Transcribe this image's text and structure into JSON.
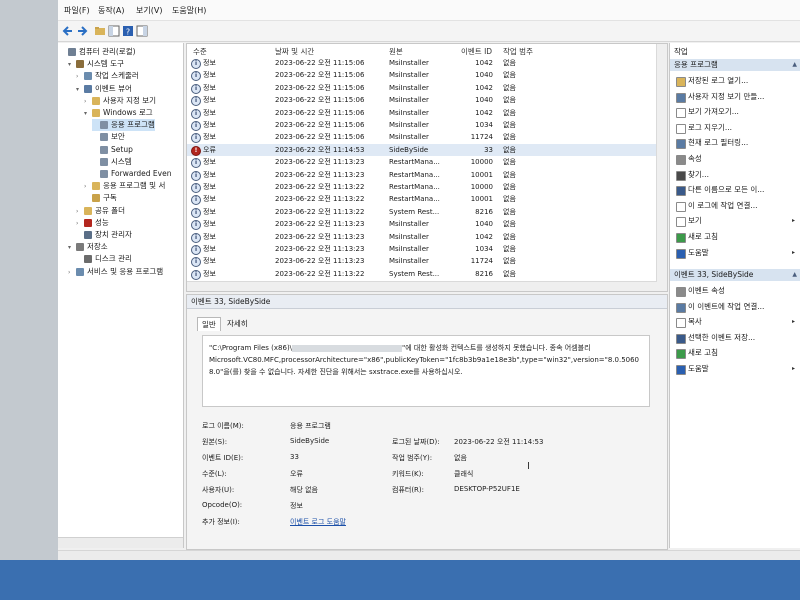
{
  "menu": {
    "items": [
      "파일(F)",
      "동작(A)",
      "보기(V)",
      "도움말(H)"
    ]
  },
  "toolbar": {
    "icons": [
      "back-arrow-icon",
      "forward-arrow-icon",
      "folder-up-icon",
      "console-tree-icon",
      "help-icon",
      "show-actions-icon"
    ]
  },
  "tree": {
    "items": [
      {
        "label": "컴퓨터 관리(로컬)",
        "level": 0,
        "expand": "",
        "icon": "computer-management-icon",
        "color": "#6f7f93"
      },
      {
        "label": "시스템 도구",
        "level": 1,
        "expand": "▾",
        "icon": "toolbox-icon",
        "color": "#8a6d3b"
      },
      {
        "label": "작업 스케줄러",
        "level": 2,
        "expand": "›",
        "icon": "clock-icon",
        "color": "#6b8cae"
      },
      {
        "label": "이벤트 뷰어",
        "level": 2,
        "expand": "▾",
        "icon": "event-viewer-icon",
        "color": "#5a7ba3"
      },
      {
        "label": "사용자 지정 보기",
        "level": 3,
        "expand": "›",
        "icon": "folder-icon",
        "color": "#d9b45a"
      },
      {
        "label": "Windows 로그",
        "level": 3,
        "expand": "▾",
        "icon": "folder-icon",
        "color": "#d9b45a"
      },
      {
        "label": "응용 프로그램",
        "level": 4,
        "expand": "",
        "icon": "log-icon",
        "color": "#7f8fa3",
        "selected": true
      },
      {
        "label": "보안",
        "level": 4,
        "expand": "",
        "icon": "log-icon",
        "color": "#7f8fa3"
      },
      {
        "label": "Setup",
        "level": 4,
        "expand": "",
        "icon": "log-icon",
        "color": "#7f8fa3"
      },
      {
        "label": "시스템",
        "level": 4,
        "expand": "",
        "icon": "log-icon",
        "color": "#7f8fa3"
      },
      {
        "label": "Forwarded Even",
        "level": 4,
        "expand": "",
        "icon": "log-icon",
        "color": "#7f8fa3"
      },
      {
        "label": "응용 프로그램 및 서",
        "level": 3,
        "expand": "›",
        "icon": "folder-icon",
        "color": "#d9b45a"
      },
      {
        "label": "구독",
        "level": 3,
        "expand": "",
        "icon": "subscription-icon",
        "color": "#c9a24a"
      },
      {
        "label": "공유 폴더",
        "level": 2,
        "expand": "›",
        "icon": "shared-folder-icon",
        "color": "#d9b45a"
      },
      {
        "label": "성능",
        "level": 2,
        "expand": "›",
        "icon": "performance-icon",
        "color": "#b3261e"
      },
      {
        "label": "장치 관리자",
        "level": 2,
        "expand": "",
        "icon": "device-manager-icon",
        "color": "#5a6e87"
      },
      {
        "label": "저장소",
        "level": 1,
        "expand": "▾",
        "icon": "storage-icon",
        "color": "#7a7a7a"
      },
      {
        "label": "디스크 관리",
        "level": 2,
        "expand": "",
        "icon": "disk-icon",
        "color": "#6b6b6b"
      },
      {
        "label": "서비스 및 응용 프로그램",
        "level": 1,
        "expand": "›",
        "icon": "services-icon",
        "color": "#6b8cae"
      }
    ]
  },
  "events": {
    "columns": [
      "수준",
      "날짜 및 시간",
      "원본",
      "이벤트 ID",
      "작업 범주"
    ],
    "rows": [
      {
        "level": "정보",
        "type": "info",
        "datetime": "2023-06-22 오전 11:15:06",
        "source": "MsiInstaller",
        "id": "1042",
        "category": "없음"
      },
      {
        "level": "정보",
        "type": "info",
        "datetime": "2023-06-22 오전 11:15:06",
        "source": "MsiInstaller",
        "id": "1040",
        "category": "없음"
      },
      {
        "level": "정보",
        "type": "info",
        "datetime": "2023-06-22 오전 11:15:06",
        "source": "MsiInstaller",
        "id": "1042",
        "category": "없음"
      },
      {
        "level": "정보",
        "type": "info",
        "datetime": "2023-06-22 오전 11:15:06",
        "source": "MsiInstaller",
        "id": "1040",
        "category": "없음"
      },
      {
        "level": "정보",
        "type": "info",
        "datetime": "2023-06-22 오전 11:15:06",
        "source": "MsiInstaller",
        "id": "1042",
        "category": "없음"
      },
      {
        "level": "정보",
        "type": "info",
        "datetime": "2023-06-22 오전 11:15:06",
        "source": "MsiInstaller",
        "id": "1034",
        "category": "없음"
      },
      {
        "level": "정보",
        "type": "info",
        "datetime": "2023-06-22 오전 11:15:06",
        "source": "MsiInstaller",
        "id": "11724",
        "category": "없음"
      },
      {
        "level": "오류",
        "type": "error",
        "datetime": "2023-06-22 오전 11:14:53",
        "source": "SideBySide",
        "id": "33",
        "category": "없음",
        "selected": true
      },
      {
        "level": "정보",
        "type": "info",
        "datetime": "2023-06-22 오전 11:13:23",
        "source": "RestartMana...",
        "id": "10000",
        "category": "없음"
      },
      {
        "level": "정보",
        "type": "info",
        "datetime": "2023-06-22 오전 11:13:23",
        "source": "RestartMana...",
        "id": "10001",
        "category": "없음"
      },
      {
        "level": "정보",
        "type": "info",
        "datetime": "2023-06-22 오전 11:13:22",
        "source": "RestartMana...",
        "id": "10000",
        "category": "없음"
      },
      {
        "level": "정보",
        "type": "info",
        "datetime": "2023-06-22 오전 11:13:22",
        "source": "RestartMana...",
        "id": "10001",
        "category": "없음"
      },
      {
        "level": "정보",
        "type": "info",
        "datetime": "2023-06-22 오전 11:13:22",
        "source": "System Rest...",
        "id": "8216",
        "category": "없음"
      },
      {
        "level": "정보",
        "type": "info",
        "datetime": "2023-06-22 오전 11:13:23",
        "source": "MsiInstaller",
        "id": "1040",
        "category": "없음"
      },
      {
        "level": "정보",
        "type": "info",
        "datetime": "2023-06-22 오전 11:13:23",
        "source": "MsiInstaller",
        "id": "1042",
        "category": "없음"
      },
      {
        "level": "정보",
        "type": "info",
        "datetime": "2023-06-22 오전 11:13:23",
        "source": "MsiInstaller",
        "id": "1034",
        "category": "없음"
      },
      {
        "level": "정보",
        "type": "info",
        "datetime": "2023-06-22 오전 11:13:23",
        "source": "MsiInstaller",
        "id": "11724",
        "category": "없음"
      },
      {
        "level": "정보",
        "type": "info",
        "datetime": "2023-06-22 오전 11:13:22",
        "source": "System Rest...",
        "id": "8216",
        "category": "없음"
      }
    ]
  },
  "detail": {
    "header": "이벤트 33, SideBySide",
    "tabs": [
      "일반",
      "자세히"
    ],
    "message_lines": [
      {
        "before": "\"C:\\Program Files (x86)\\",
        "redacted": true,
        "after": "\"에 대한 활성화 컨텍스트를 생성하지 못했습니다. 종속 어셈블리"
      },
      {
        "before": "Microsoft.VC80.MFC,processorArchitecture=\"x86\",publicKeyToken=\"1fc8b3b9a1e18e3b\",type=\"win32\",version=\"8.0.5060",
        "redacted": false,
        "after": ""
      },
      {
        "before": "8.0\"을(를) 찾을 수 없습니다. 자세한 진단을 위해서는 sxstrace.exe를 사용하십시오.",
        "redacted": false,
        "after": ""
      }
    ],
    "props": {
      "log_name_label": "로그 이름(M):",
      "log_name": "응용 프로그램",
      "source_label": "원본(S):",
      "source": "SideBySide",
      "logged_label": "로그된 날짜(D):",
      "logged": "2023-06-22 오전 11:14:53",
      "event_id_label": "이벤트 ID(E):",
      "event_id": "33",
      "task_label": "작업 범주(Y):",
      "task": "없음",
      "level_label": "수준(L):",
      "level": "오류",
      "keywords_label": "키워드(K):",
      "keywords": "클래식",
      "user_label": "사용자(U):",
      "user": "해당 없음",
      "computer_label": "컴퓨터(R):",
      "computer": "DESKTOP-P52UF1E",
      "opcode_label": "Opcode(O):",
      "opcode": "정보",
      "more_info_label": "추가 정보(I):",
      "more_info": "이벤트 로그 도움말"
    }
  },
  "actions": {
    "title": "작업",
    "section1": "응용 프로그램",
    "items1": [
      {
        "label": "저장된 로그 열기...",
        "icon": "open-log-icon",
        "color": "#d9b45a",
        "sub": ""
      },
      {
        "label": "사용자 지정 보기 만들...",
        "icon": "filter-icon",
        "color": "#5a7ba3",
        "sub": ""
      },
      {
        "label": "보기 가져오기...",
        "icon": "import-icon",
        "color": "#ffffff",
        "sub": ""
      },
      {
        "label": "로그 지우기...",
        "icon": "clear-log-icon",
        "color": "#ffffff",
        "sub": ""
      },
      {
        "label": "현재 로그 필터링...",
        "icon": "filter-icon",
        "color": "#5a7ba3",
        "sub": ""
      },
      {
        "label": "속성",
        "icon": "properties-icon",
        "color": "#8a8a8a",
        "sub": ""
      },
      {
        "label": "찾기...",
        "icon": "find-icon",
        "color": "#4a4a4a",
        "sub": ""
      },
      {
        "label": "다른 이름으로 모든 이...",
        "icon": "save-icon",
        "color": "#3a5a8a",
        "sub": ""
      },
      {
        "label": "이 로그에 작업 연결...",
        "icon": "attach-task-icon",
        "color": "#ffffff",
        "sub": ""
      },
      {
        "label": "보기",
        "icon": "view-icon",
        "color": "#ffffff",
        "sub": "▸"
      },
      {
        "label": "새로 고침",
        "icon": "refresh-icon",
        "color": "#3c9a4a",
        "sub": ""
      },
      {
        "label": "도움말",
        "icon": "help-icon",
        "color": "#2a5fb0",
        "sub": "▸"
      }
    ],
    "section2": "이벤트 33, SideBySide",
    "items2": [
      {
        "label": "이벤트 속성",
        "icon": "event-properties-icon",
        "color": "#8a8a8a",
        "sub": ""
      },
      {
        "label": "이 이벤트에 작업 연결...",
        "icon": "attach-task-icon",
        "color": "#5a7ba3",
        "sub": ""
      },
      {
        "label": "복사",
        "icon": "copy-icon",
        "color": "#ffffff",
        "sub": "▸"
      },
      {
        "label": "선택한 이벤트 저장...",
        "icon": "save-icon",
        "color": "#3a5a8a",
        "sub": ""
      },
      {
        "label": "새로 고침",
        "icon": "refresh-icon",
        "color": "#3c9a4a",
        "sub": ""
      },
      {
        "label": "도움말",
        "icon": "help-icon",
        "color": "#2a5fb0",
        "sub": "▸"
      }
    ]
  }
}
